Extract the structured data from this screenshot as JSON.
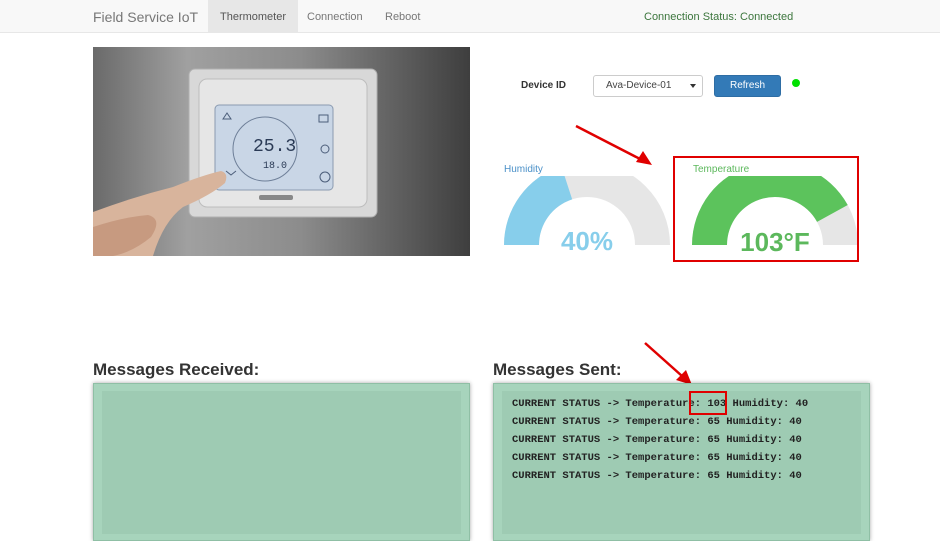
{
  "navbar": {
    "brand": "Field Service IoT",
    "tabs": [
      "Thermometer",
      "Connection",
      "Reboot"
    ],
    "connection_status": "Connection Status: Connected"
  },
  "device": {
    "label": "Device ID",
    "selected": "Ava-Device-01",
    "refresh_label": "Refresh",
    "status_color": "#00e000"
  },
  "gauges": {
    "humidity": {
      "title": "Humidity",
      "value_text": "40%",
      "fraction": 0.4,
      "color": "#87ceeb"
    },
    "temperature": {
      "title": "Temperature",
      "value_text": "103°F",
      "fraction": 0.84,
      "color": "#5cb85c"
    }
  },
  "thermostat_display": {
    "temp": "25.3",
    "set": "18.0"
  },
  "messages_received": {
    "title": "Messages Received:",
    "lines": []
  },
  "messages_sent": {
    "title": "Messages Sent:",
    "lines": [
      "CURRENT STATUS -> Temperature: 103 Humidity: 40",
      "CURRENT STATUS -> Temperature: 65 Humidity: 40",
      "CURRENT STATUS -> Temperature: 65 Humidity: 40",
      "CURRENT STATUS -> Temperature: 65 Humidity: 40",
      "CURRENT STATUS -> Temperature: 65 Humidity: 40"
    ]
  }
}
